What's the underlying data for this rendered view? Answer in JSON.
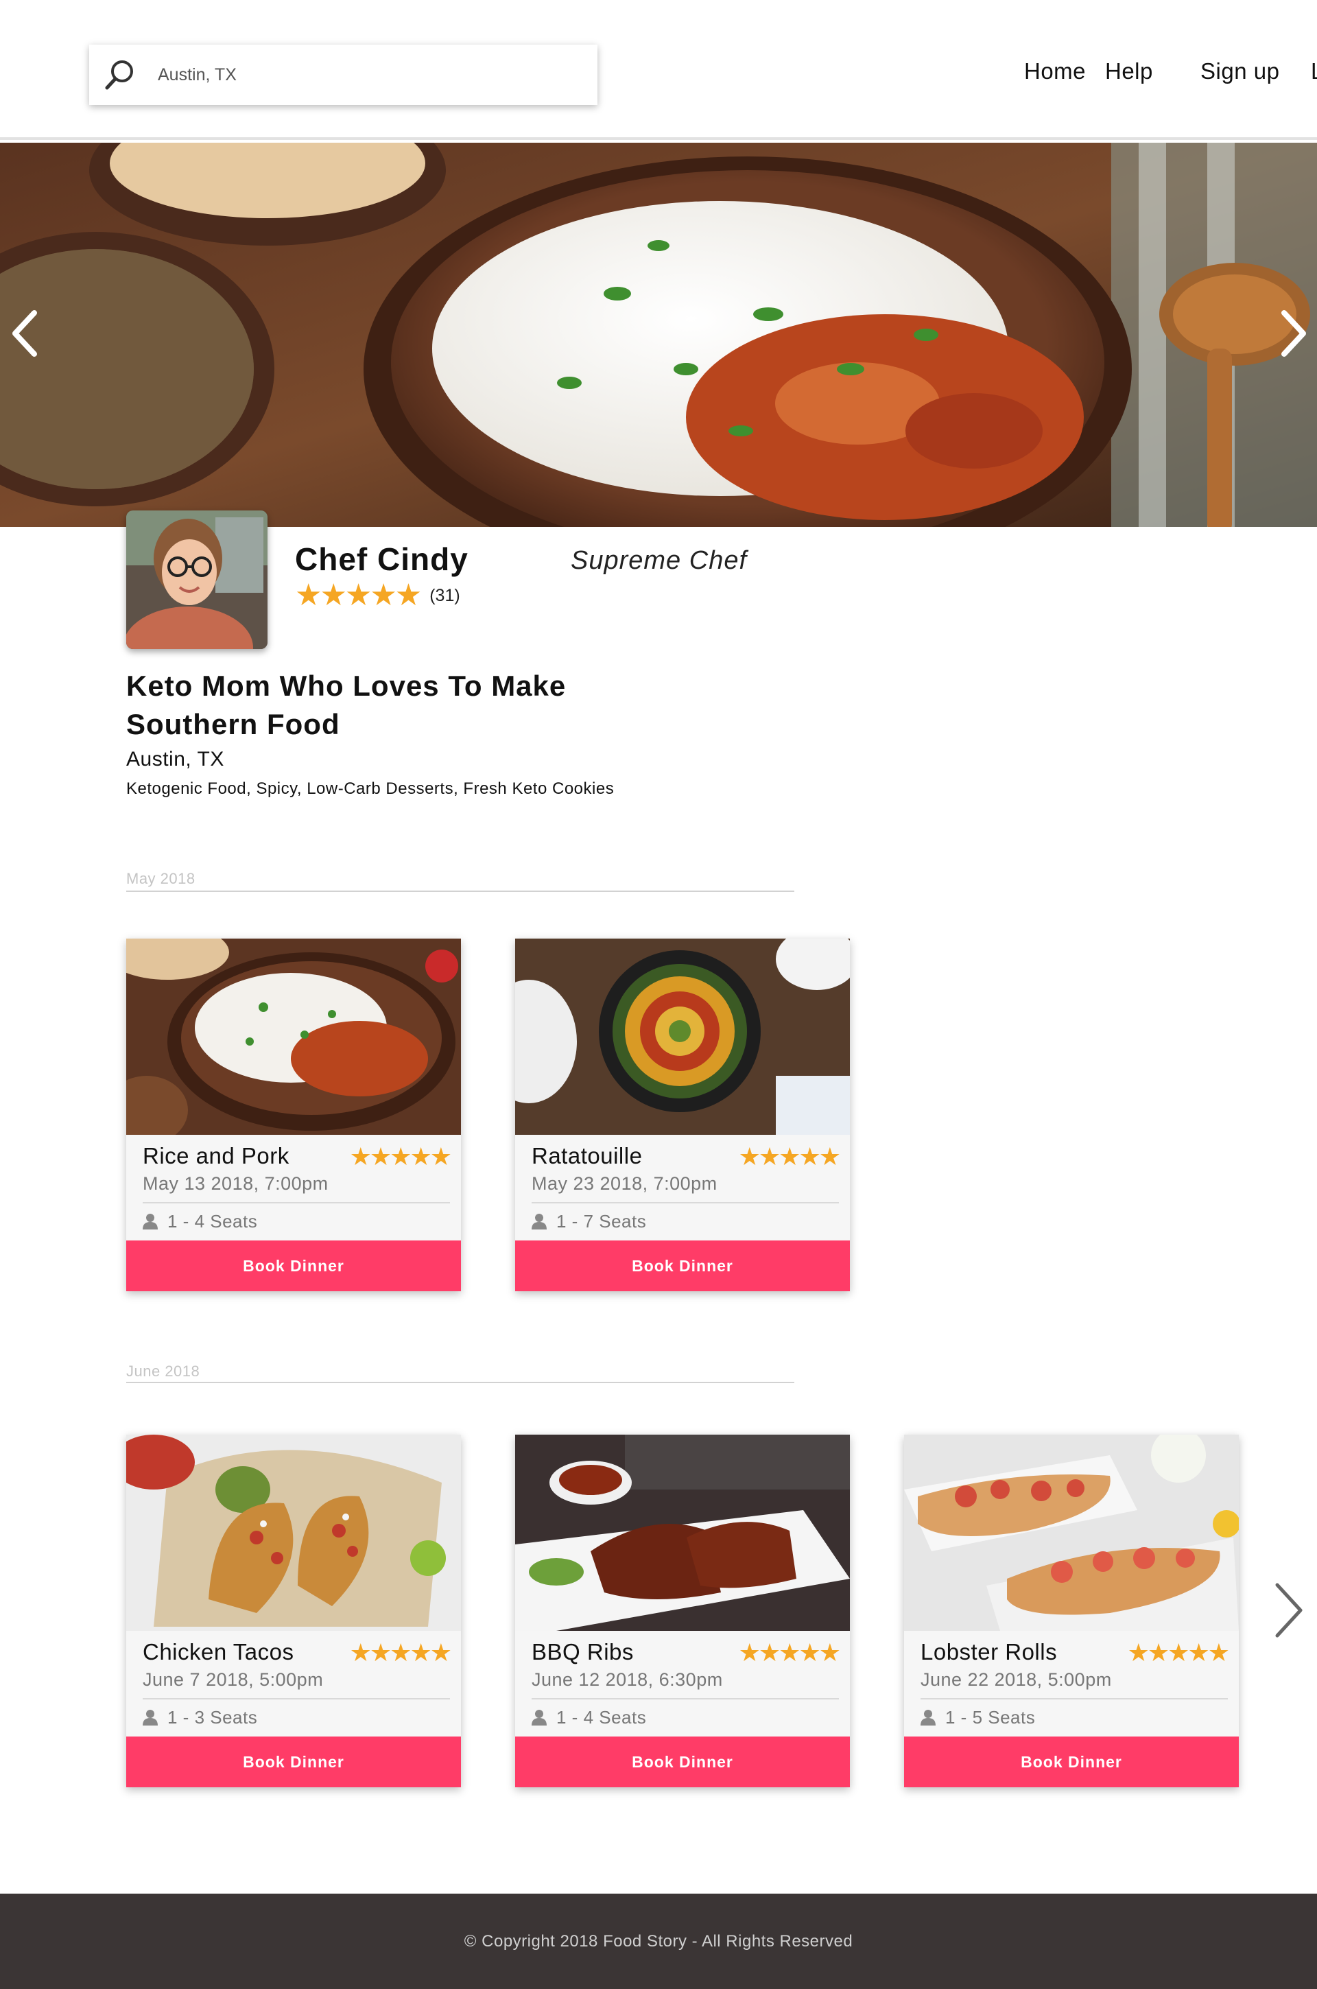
{
  "search": {
    "value": "Austin, TX",
    "icon": "search-icon"
  },
  "nav": {
    "items": [
      "Home",
      "Help",
      "Sign up",
      "Log in"
    ]
  },
  "chef": {
    "name": "Chef Cindy",
    "stars": "★★★★★",
    "rating_count": "(31)",
    "title": "Supreme Chef",
    "tagline": "Keto Mom Who Loves To Make Southern Food",
    "location": "Austin, TX",
    "specialties": "Ketogenic Food, Spicy, Low-Carb Desserts, Fresh Keto Cookies"
  },
  "sections": [
    {
      "month": "May 2018",
      "dinners": [
        {
          "name": "Rice and Pork",
          "stars": "★★★★★",
          "date": "May 13 2018, 7:00pm",
          "seats": "1 - 4 Seats",
          "button": "Book Dinner"
        },
        {
          "name": "Ratatouille",
          "stars": "★★★★★",
          "date": "May 23 2018, 7:00pm",
          "seats": "1 - 7 Seats",
          "button": "Book Dinner"
        }
      ]
    },
    {
      "month": "June 2018",
      "dinners": [
        {
          "name": "Chicken Tacos",
          "stars": "★★★★★",
          "date": "June 7 2018, 5:00pm",
          "seats": "1 - 3 Seats",
          "button": "Book Dinner"
        },
        {
          "name": "BBQ Ribs",
          "stars": "★★★★★",
          "date": "June 12 2018, 6:30pm",
          "seats": "1 - 4 Seats",
          "button": "Book Dinner"
        },
        {
          "name": "Lobster Rolls",
          "stars": "★★★★★",
          "date": "June 22 2018, 5:00pm",
          "seats": "1 - 5 Seats",
          "button": "Book Dinner"
        }
      ]
    }
  ],
  "footer": {
    "copyright": "© Copyright 2018 Food Story - All Rights Reserved"
  },
  "colors": {
    "accent": "#ff3c67",
    "stars": "#f5a623",
    "footer_bg": "#3b3535"
  }
}
